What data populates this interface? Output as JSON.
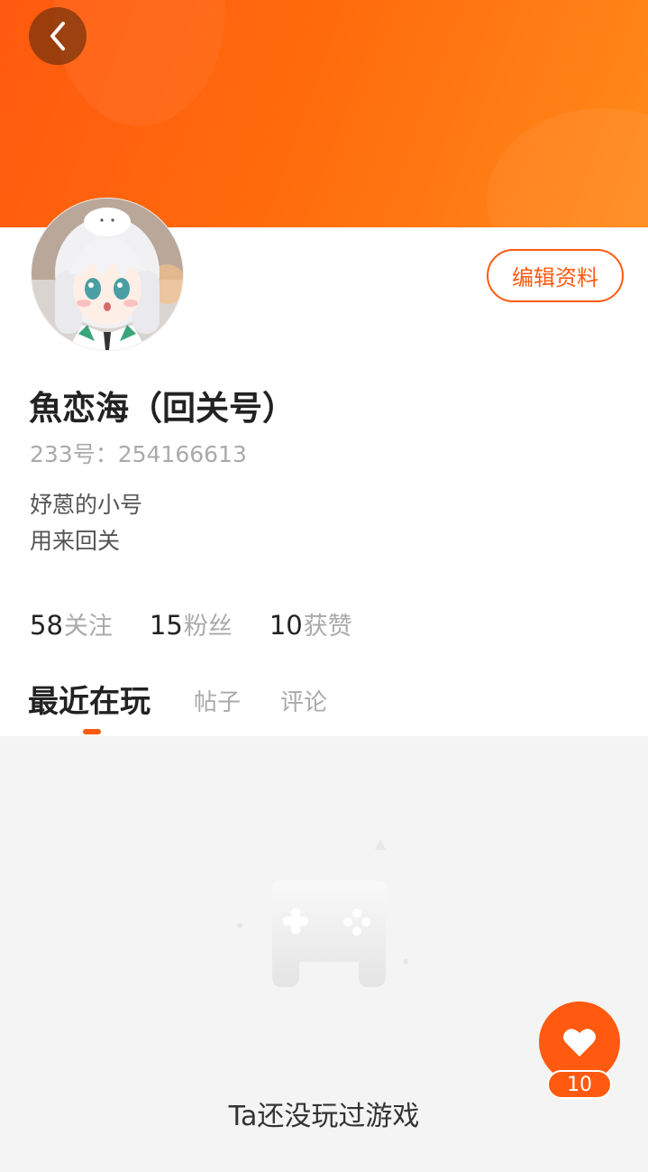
{
  "header": {
    "back_icon": "chevron-left-icon"
  },
  "profile": {
    "edit_button_label": "编辑资料",
    "nickname": "魚恋海（回关号）",
    "id_label": "233号：",
    "id_value": "254166613",
    "bio_lines": [
      "妤蒽的小号",
      "用来回关"
    ]
  },
  "stats": [
    {
      "value": "58",
      "label": "关注"
    },
    {
      "value": "15",
      "label": "粉丝"
    },
    {
      "value": "10",
      "label": "获赞"
    }
  ],
  "tabs": [
    {
      "label": "最近在玩",
      "active": true
    },
    {
      "label": "帖子",
      "active": false
    },
    {
      "label": "评论",
      "active": false
    }
  ],
  "content": {
    "empty_icon": "gamepad-icon",
    "empty_text": "Ta还没玩过游戏"
  },
  "like": {
    "icon": "heart-icon",
    "count": "10"
  },
  "colors": {
    "accent": "#ff5a10",
    "banner_start": "#ff5a10",
    "banner_end": "#ff8a1a"
  }
}
